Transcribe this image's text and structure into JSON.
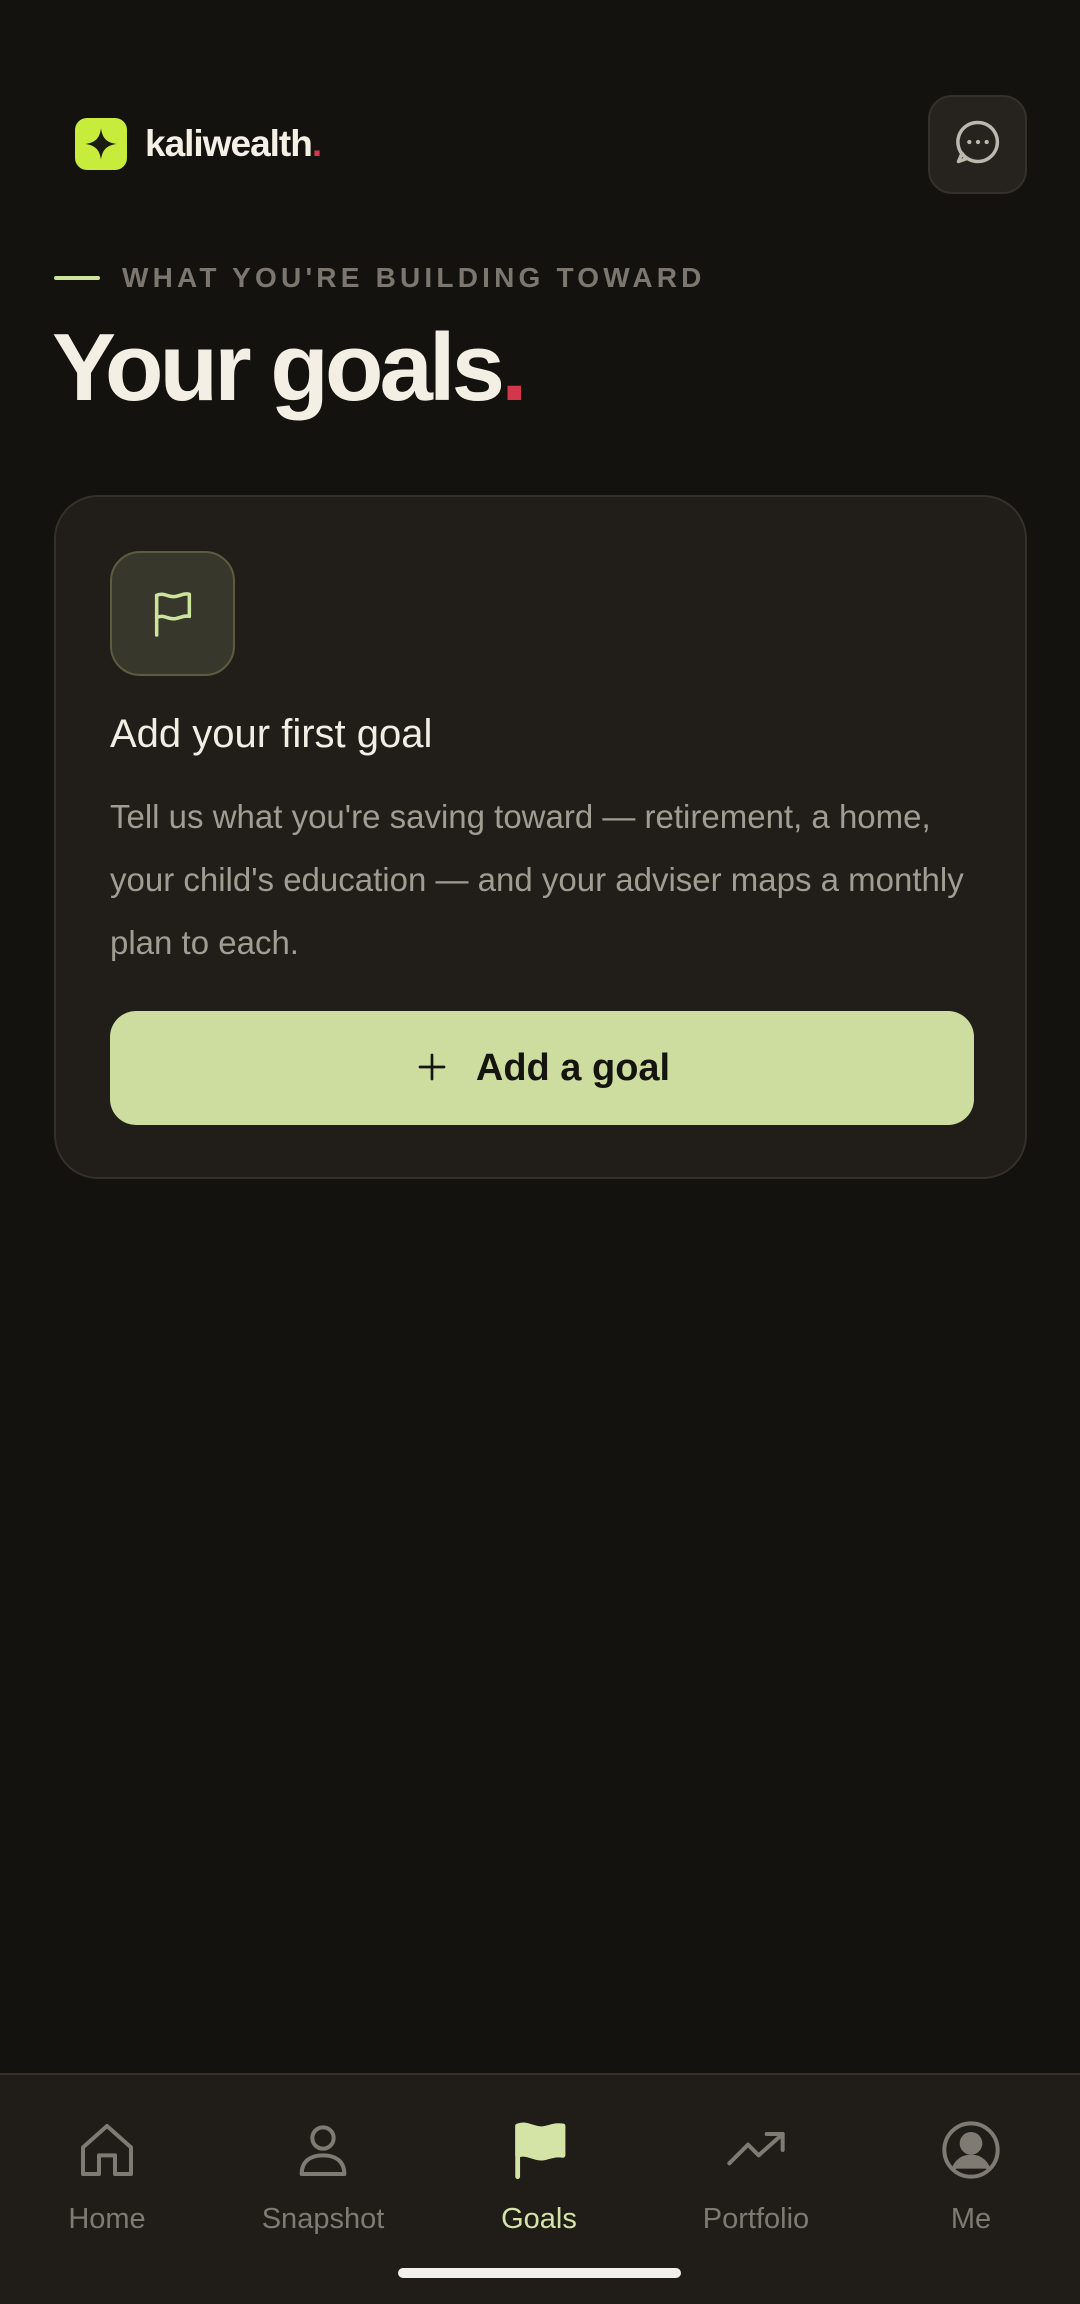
{
  "brand": {
    "name": "kaliwealth",
    "dot": ".",
    "logo_icon": "sparkle-icon",
    "logo_color": "#c8ec3c"
  },
  "header": {
    "chat_icon": "chat-bubble-icon"
  },
  "section": {
    "eyebrow": "WHAT YOU'RE BUILDING TOWARD",
    "title": "Your goals",
    "title_dot": "."
  },
  "empty_state": {
    "icon": "flag-icon",
    "title": "Add your first goal",
    "body": "Tell us what you're saving toward — retirement, a home, your child's education — and your adviser maps a monthly plan to each.",
    "button_icon": "plus-icon",
    "button_label": "Add a goal"
  },
  "nav": {
    "items": [
      {
        "label": "Home",
        "icon": "home-icon"
      },
      {
        "label": "Snapshot",
        "icon": "person-icon"
      },
      {
        "label": "Goals",
        "icon": "flag-icon",
        "active": true
      },
      {
        "label": "Portfolio",
        "icon": "trending-up-icon"
      },
      {
        "label": "Me",
        "icon": "profile-circle-icon"
      }
    ]
  },
  "colors": {
    "background": "#13120e",
    "accent": "#cddd9f",
    "brand_red": "#d2374b",
    "card": "#211d19"
  }
}
